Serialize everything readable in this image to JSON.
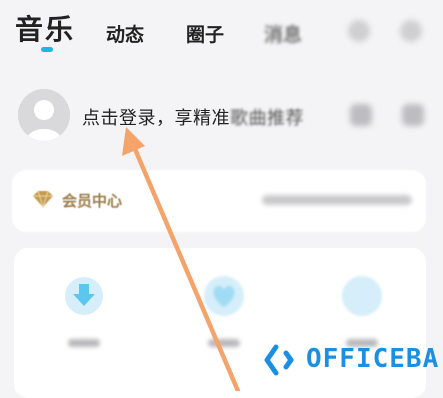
{
  "tabs": [
    {
      "label": "音乐",
      "active": true
    },
    {
      "label": "动态"
    },
    {
      "label": "圈子"
    },
    {
      "label": "消息"
    }
  ],
  "login": {
    "text_clear": "点击登录，享精准",
    "text_faded": "歌曲推荐"
  },
  "vip": {
    "label": "会员中心"
  },
  "quick_actions": [
    {
      "icon": "download-icon"
    },
    {
      "icon": "heart-icon"
    },
    {
      "icon": "history-icon"
    }
  ],
  "watermark": {
    "text": "OFFICEBA"
  },
  "colors": {
    "accent": "#19b8e0",
    "vip": "#c49a4f",
    "arrow": "#f4a46a",
    "brand": "#1b8fe3"
  }
}
